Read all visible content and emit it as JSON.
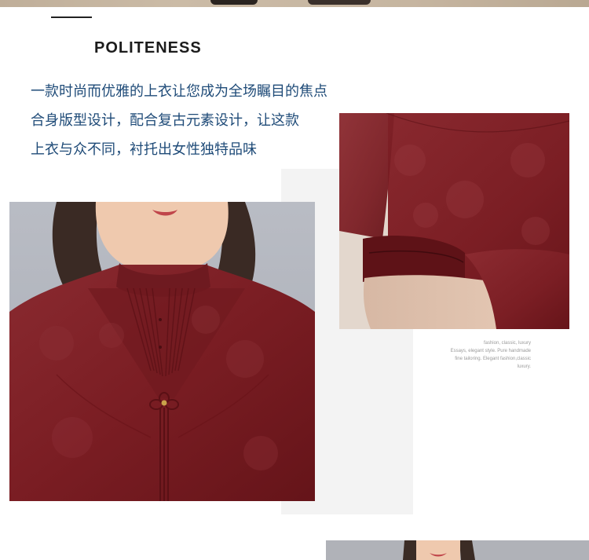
{
  "heading": "POLITENESS",
  "description": [
    "一款时尚而优雅的上衣让您成为全场瞩目的焦点",
    "合身版型设计，配合复古元素设计，让这款",
    "上衣与众不同，衬托出女性独特品味"
  ],
  "caption": [
    "fashion, classic, luxury",
    "Essays, elegant style. Pure handmade",
    "fine tailoring. Elegant fashion,classic",
    "luxury."
  ],
  "colors": {
    "heading": "#1c1c1c",
    "description": "#1f4b78",
    "garment": "#7a1d23",
    "caption": "#9a9a9a"
  }
}
